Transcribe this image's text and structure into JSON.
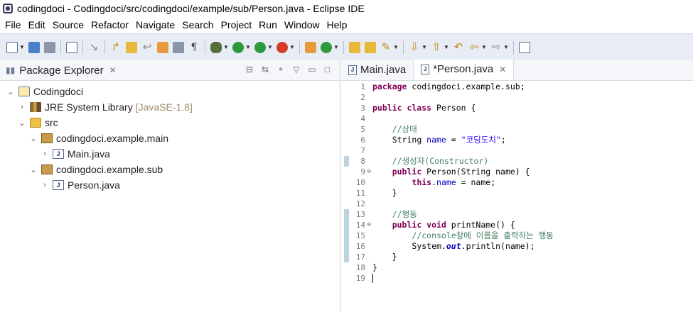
{
  "window": {
    "title": "codingdoci - Codingdoci/src/codingdoci/example/sub/Person.java - Eclipse IDE"
  },
  "menu": [
    "File",
    "Edit",
    "Source",
    "Refactor",
    "Navigate",
    "Search",
    "Project",
    "Run",
    "Window",
    "Help"
  ],
  "package_explorer": {
    "title": "Package Explorer",
    "tree": {
      "project": "Codingdoci",
      "library": "JRE System Library",
      "library_decoration": "[JavaSE-1.8]",
      "src": "src",
      "pkg_main": "codingdoci.example.main",
      "file_main": "Main.java",
      "pkg_sub": "codingdoci.example.sub",
      "file_person": "Person.java"
    }
  },
  "editor": {
    "tabs": [
      {
        "label": "Main.java",
        "active": false
      },
      {
        "label": "*Person.java",
        "active": true
      }
    ],
    "line_numbers": [
      "1",
      "2",
      "3",
      "4",
      "5",
      "6",
      "7",
      "8",
      "9",
      "10",
      "11",
      "12",
      "13",
      "14",
      "15",
      "16",
      "17",
      "18",
      "19"
    ],
    "code": {
      "l1_kw": "package",
      "l1_rest": " codingdoci.example.sub;",
      "l3_kw": "public class",
      "l3_rest": " Person {",
      "l5_comment": "//상태",
      "l6_type": "String ",
      "l6_field": "name",
      "l6_eq": " = ",
      "l6_str": "\"코딩도치\"",
      "l6_end": ";",
      "l8_comment": "//생성자(Constructor)",
      "l9_kw": "public",
      "l9_rest": " Person(String name) {",
      "l10_kw": "this",
      "l10_dot": ".",
      "l10_field": "name",
      "l10_rest": " = name;",
      "l11": "}",
      "l13_comment": "//행동",
      "l14_kw": "public void",
      "l14_rest": " printName() {",
      "l15_comment": "//console창에 이름을 출력하는 행동",
      "l16_a": "System.",
      "l16_out": "out",
      "l16_b": ".println(name);",
      "l17": "}",
      "l18": "}"
    }
  }
}
